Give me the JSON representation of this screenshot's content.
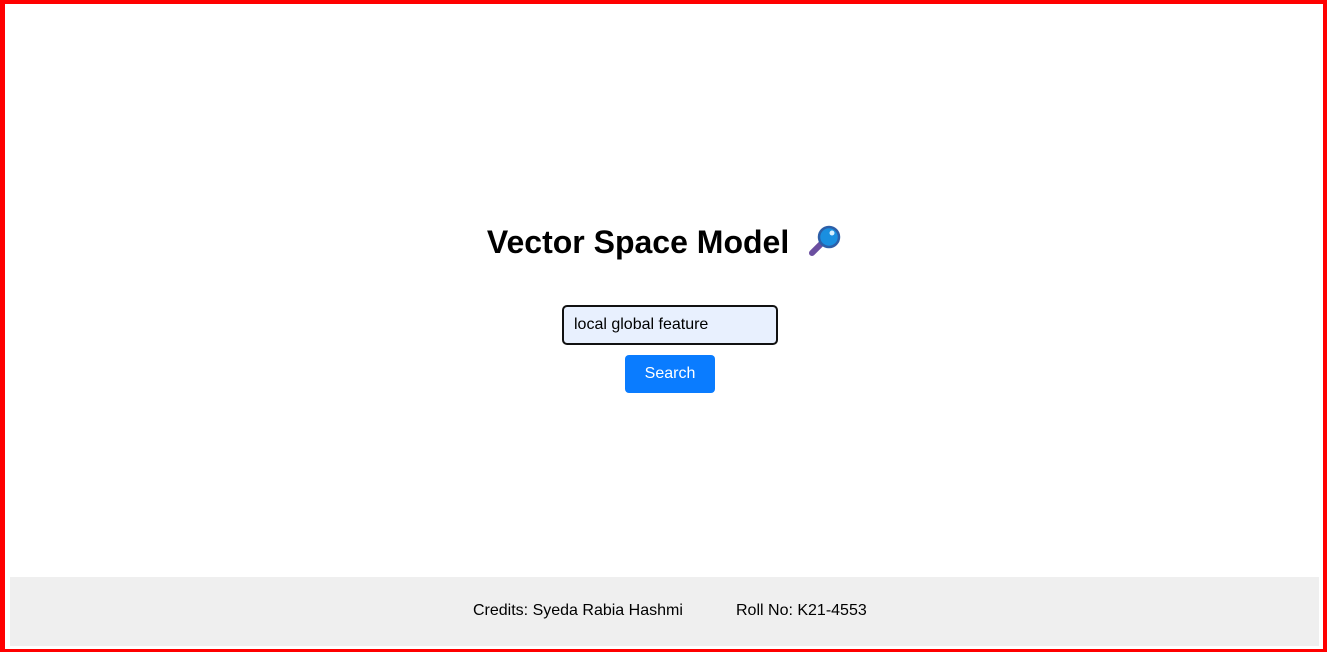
{
  "header": {
    "title": "Vector Space Model",
    "title_icon": "magnifying-glass-icon"
  },
  "search": {
    "value": "local global feature ",
    "button_label": "Search"
  },
  "footer": {
    "credits": "Credits: Syeda Rabia Hashmi",
    "roll_no": "Roll No: K21-4553"
  },
  "colors": {
    "frame_border": "#ff0000",
    "button_bg": "#0a7cff",
    "input_bg": "#e8f0fe",
    "footer_bg": "#efefef"
  }
}
